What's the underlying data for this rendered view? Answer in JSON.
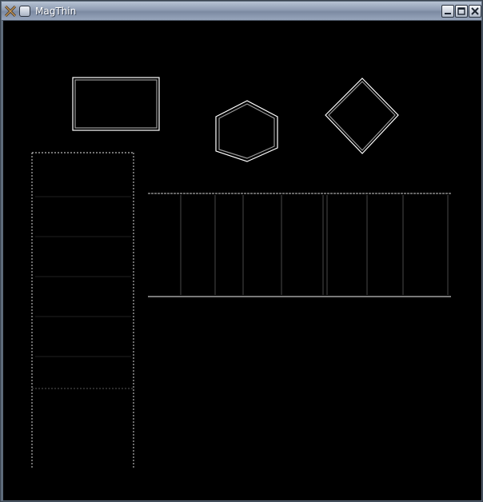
{
  "window": {
    "title": "MagThin",
    "icons": {
      "app": "mag-app-icon",
      "sticky": "sticky-icon",
      "minimize": "minimize-icon",
      "maximize": "maximize-icon",
      "close": "close-icon"
    }
  },
  "colors": {
    "titlebar_text": "#ffffff",
    "canvas_background": "#000000",
    "edge_color": "#ffffff",
    "frame": "#5d6a7a"
  }
}
